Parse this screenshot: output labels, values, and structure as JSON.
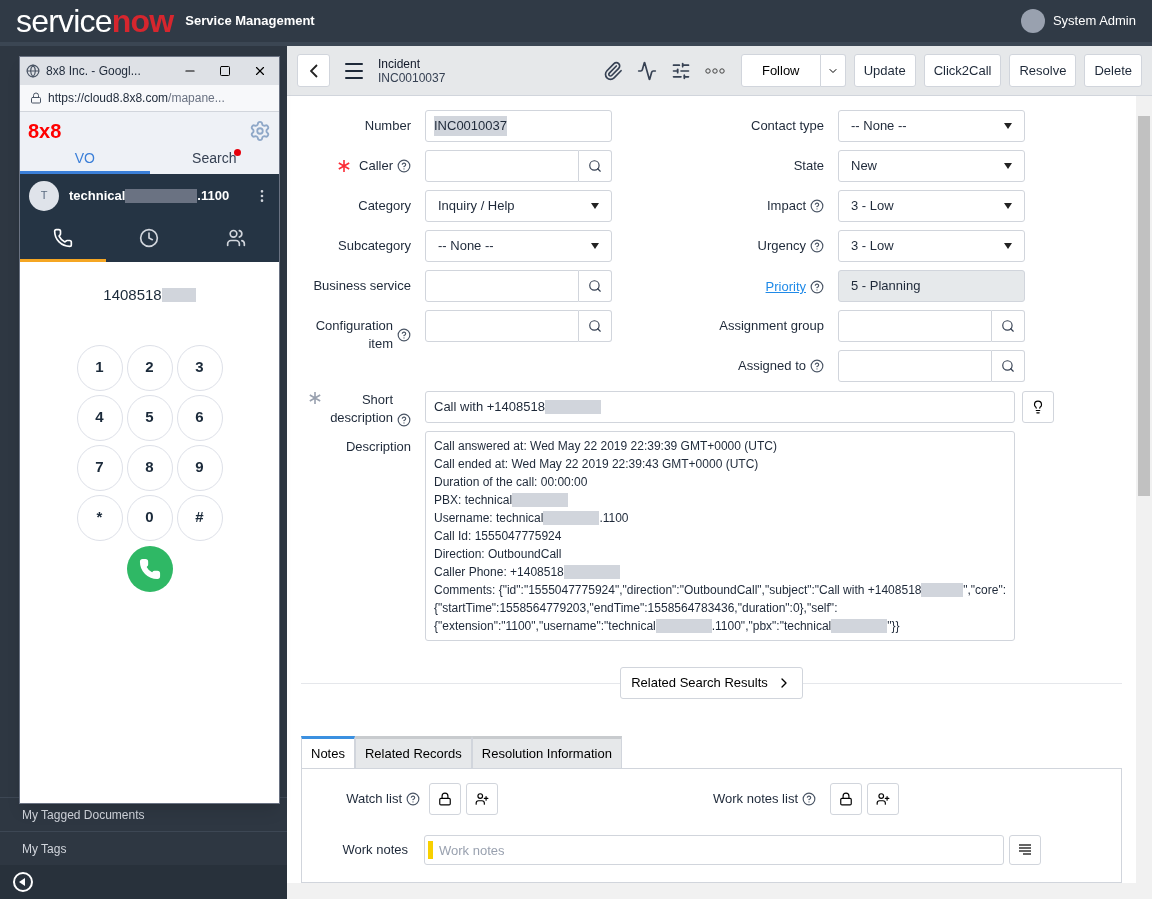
{
  "header": {
    "logo": [
      "service",
      "now"
    ],
    "title": "Service Management",
    "user": "System Admin"
  },
  "sidebar": {
    "items": [
      "My Tagged Documents",
      "My Tags"
    ]
  },
  "popup": {
    "title": "8x8 Inc. - Googl...",
    "url_host": "https://cloud8.8x8.com",
    "url_path": "/mapane...",
    "brand": "8x8",
    "tabs": [
      {
        "label": "VO",
        "selected": true,
        "notification": false
      },
      {
        "label": "Search",
        "selected": false,
        "notification": true
      }
    ],
    "user": {
      "initial": "T",
      "name_start": "technical",
      "name_end": ".1100"
    },
    "nav": [
      {
        "kind": "phone",
        "selected": true
      },
      {
        "kind": "history",
        "selected": false
      },
      {
        "kind": "contacts",
        "selected": false
      }
    ],
    "dialed": "1408518",
    "keys": [
      "1",
      "2",
      "3",
      "4",
      "5",
      "6",
      "7",
      "8",
      "9",
      "*",
      "0",
      "#"
    ]
  },
  "toolbar": {
    "title": "Incident",
    "number": "INC0010037",
    "follow": "Follow",
    "buttons": [
      "Update",
      "Click2Call",
      "Resolve",
      "Delete"
    ]
  },
  "form": {
    "left": [
      {
        "label": "Number",
        "kind": "text",
        "value": "INC0010037",
        "highlighted": true
      },
      {
        "label": "Caller",
        "kind": "reference",
        "mandatory": true,
        "filled": false,
        "help": true
      },
      {
        "label": "Category",
        "kind": "select",
        "value": "Inquiry / Help"
      },
      {
        "label": "Subcategory",
        "kind": "select",
        "value": "-- None --"
      },
      {
        "label": "Business service",
        "kind": "reference"
      },
      {
        "label": "Configuration item",
        "kind": "reference",
        "help": true
      }
    ],
    "right": [
      {
        "label": "Contact type",
        "kind": "select",
        "value": "-- None --"
      },
      {
        "label": "State",
        "kind": "select",
        "value": "New"
      },
      {
        "label": "Impact",
        "kind": "select",
        "value": "3 - Low",
        "help": true
      },
      {
        "label": "Urgency",
        "kind": "select",
        "value": "3 - Low",
        "help": true
      },
      {
        "label": "Priority",
        "kind": "readonly",
        "value": "5 - Planning",
        "help": true,
        "link": true
      },
      {
        "label": "Assignment group",
        "kind": "reference"
      },
      {
        "label": "Assigned to",
        "kind": "reference",
        "help": true
      }
    ],
    "short_description": {
      "label": "Short description",
      "mandatory": true,
      "filled": true,
      "help": true,
      "value": "Call with +1408518"
    },
    "description": {
      "label": "Description",
      "lines": [
        [
          {
            "kind": "text",
            "text": "Call answered at: Wed May 22 2019 22:39:39 GMT+0000 (UTC)"
          }
        ],
        [
          {
            "kind": "text",
            "text": "Call ended at: Wed May 22 2019 22:39:43 GMT+0000 (UTC)"
          }
        ],
        [
          {
            "kind": "text",
            "text": "Duration of the call: 00:00:00"
          }
        ],
        [
          {
            "kind": "text",
            "text": "PBX: technical"
          },
          {
            "kind": "redacted"
          }
        ],
        [
          {
            "kind": "text",
            "text": "Username: technical"
          },
          {
            "kind": "redacted"
          },
          {
            "kind": "text",
            "text": ".1100"
          }
        ],
        [
          {
            "kind": "text",
            "text": "Call Id: 1555047775924"
          }
        ],
        [
          {
            "kind": "text",
            "text": "Direction: OutboundCall"
          }
        ],
        [
          {
            "kind": "text",
            "text": "Caller Phone: +1408518"
          },
          {
            "kind": "redacted"
          }
        ],
        [
          {
            "kind": "text",
            "text": "Comments: {\"id\":\"1555047775924\",\"direction\":\"OutboundCall\",\"subject\":\"Call with +1408518"
          },
          {
            "kind": "redacted"
          },
          {
            "kind": "text",
            "text": "\",\"core\":"
          }
        ],
        [
          {
            "kind": "text",
            "text": "{\"startTime\":1558564779203,\"endTime\":1558564783436,\"duration\":0},\"self\":"
          }
        ],
        [
          {
            "kind": "text",
            "text": "{\"extension\":\"1100\",\"username\":\"technical"
          },
          {
            "kind": "redacted"
          },
          {
            "kind": "text",
            "text": ".1100\",\"pbx\":\"technical"
          },
          {
            "kind": "redacted"
          },
          {
            "kind": "text",
            "text": "\"}}"
          }
        ]
      ]
    }
  },
  "related": "Related Search Results",
  "tabs": [
    {
      "label": "Notes",
      "selected": true
    },
    {
      "label": "Related Records",
      "selected": false
    },
    {
      "label": "Resolution Information",
      "selected": false
    }
  ],
  "notes": {
    "watch_list": "Watch list",
    "work_notes_list": "Work notes list",
    "work_notes": {
      "label": "Work notes",
      "placeholder": "Work notes"
    }
  }
}
